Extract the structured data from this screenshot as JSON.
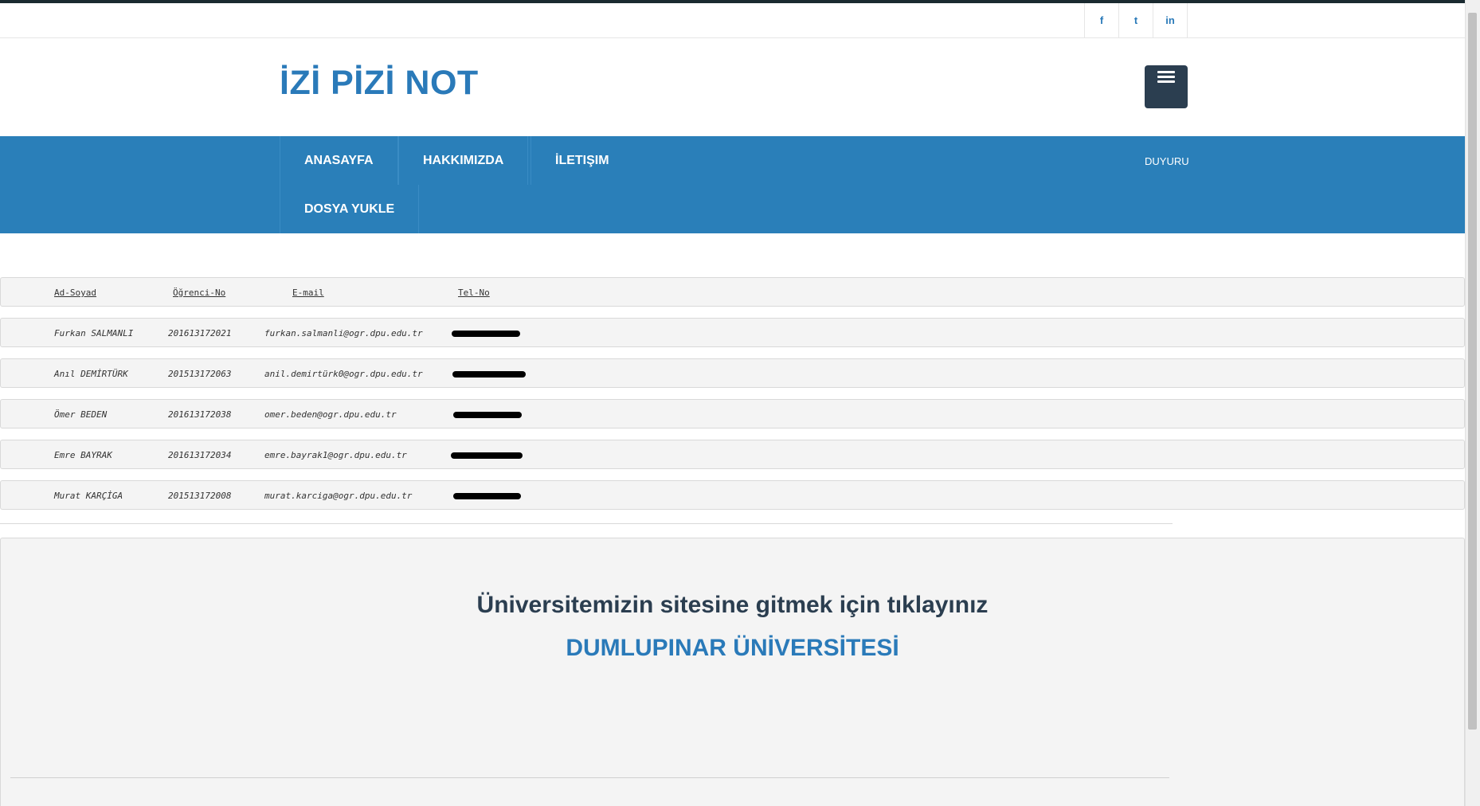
{
  "social": [
    {
      "label": "f",
      "icon": "facebook-icon"
    },
    {
      "label": "t",
      "icon": "twitter-icon"
    },
    {
      "label": "in",
      "icon": "linkedin-icon"
    }
  ],
  "brand": {
    "logo": "İZİ PİZİ NOT",
    "color": "#2a7ab9"
  },
  "nav": {
    "items": [
      "ANASAYFA",
      "HAKKIMIZDA",
      "İLETIŞIM",
      "DOSYA YUKLE"
    ],
    "right_link": "DUYURU",
    "background": "#2a7fb9"
  },
  "table": {
    "headers": [
      "Ad-Soyad",
      "Öğrenci-No",
      "E-mail",
      "Tel-No"
    ],
    "rows": [
      {
        "name": "Furkan SALMANLI",
        "student_no": "201613172021",
        "email": "furkan.salmanli@ogr.dpu.edu.tr",
        "phone_redacted": true
      },
      {
        "name": "Anıl DEMİRTÜRK",
        "student_no": "201513172063",
        "email": "anil.demirtürk0@ogr.dpu.edu.tr",
        "phone_redacted": true
      },
      {
        "name": "Ömer BEDEN",
        "student_no": "201613172038",
        "email": "omer.beden@ogr.dpu.edu.tr",
        "phone_redacted": true
      },
      {
        "name": "Emre BAYRAK",
        "student_no": "201613172034",
        "email": "emre.bayrak1@ogr.dpu.edu.tr",
        "phone_redacted": true
      },
      {
        "name": "Murat KARÇİGA",
        "student_no": "201513172008",
        "email": "murat.karciga@ogr.dpu.edu.tr",
        "phone_redacted": true
      }
    ]
  },
  "footer": {
    "text": "Üniversitemizin sitesine gitmek için tıklayınız",
    "link_text": "DUMLUPINAR ÜNİVERSİTESİ"
  }
}
